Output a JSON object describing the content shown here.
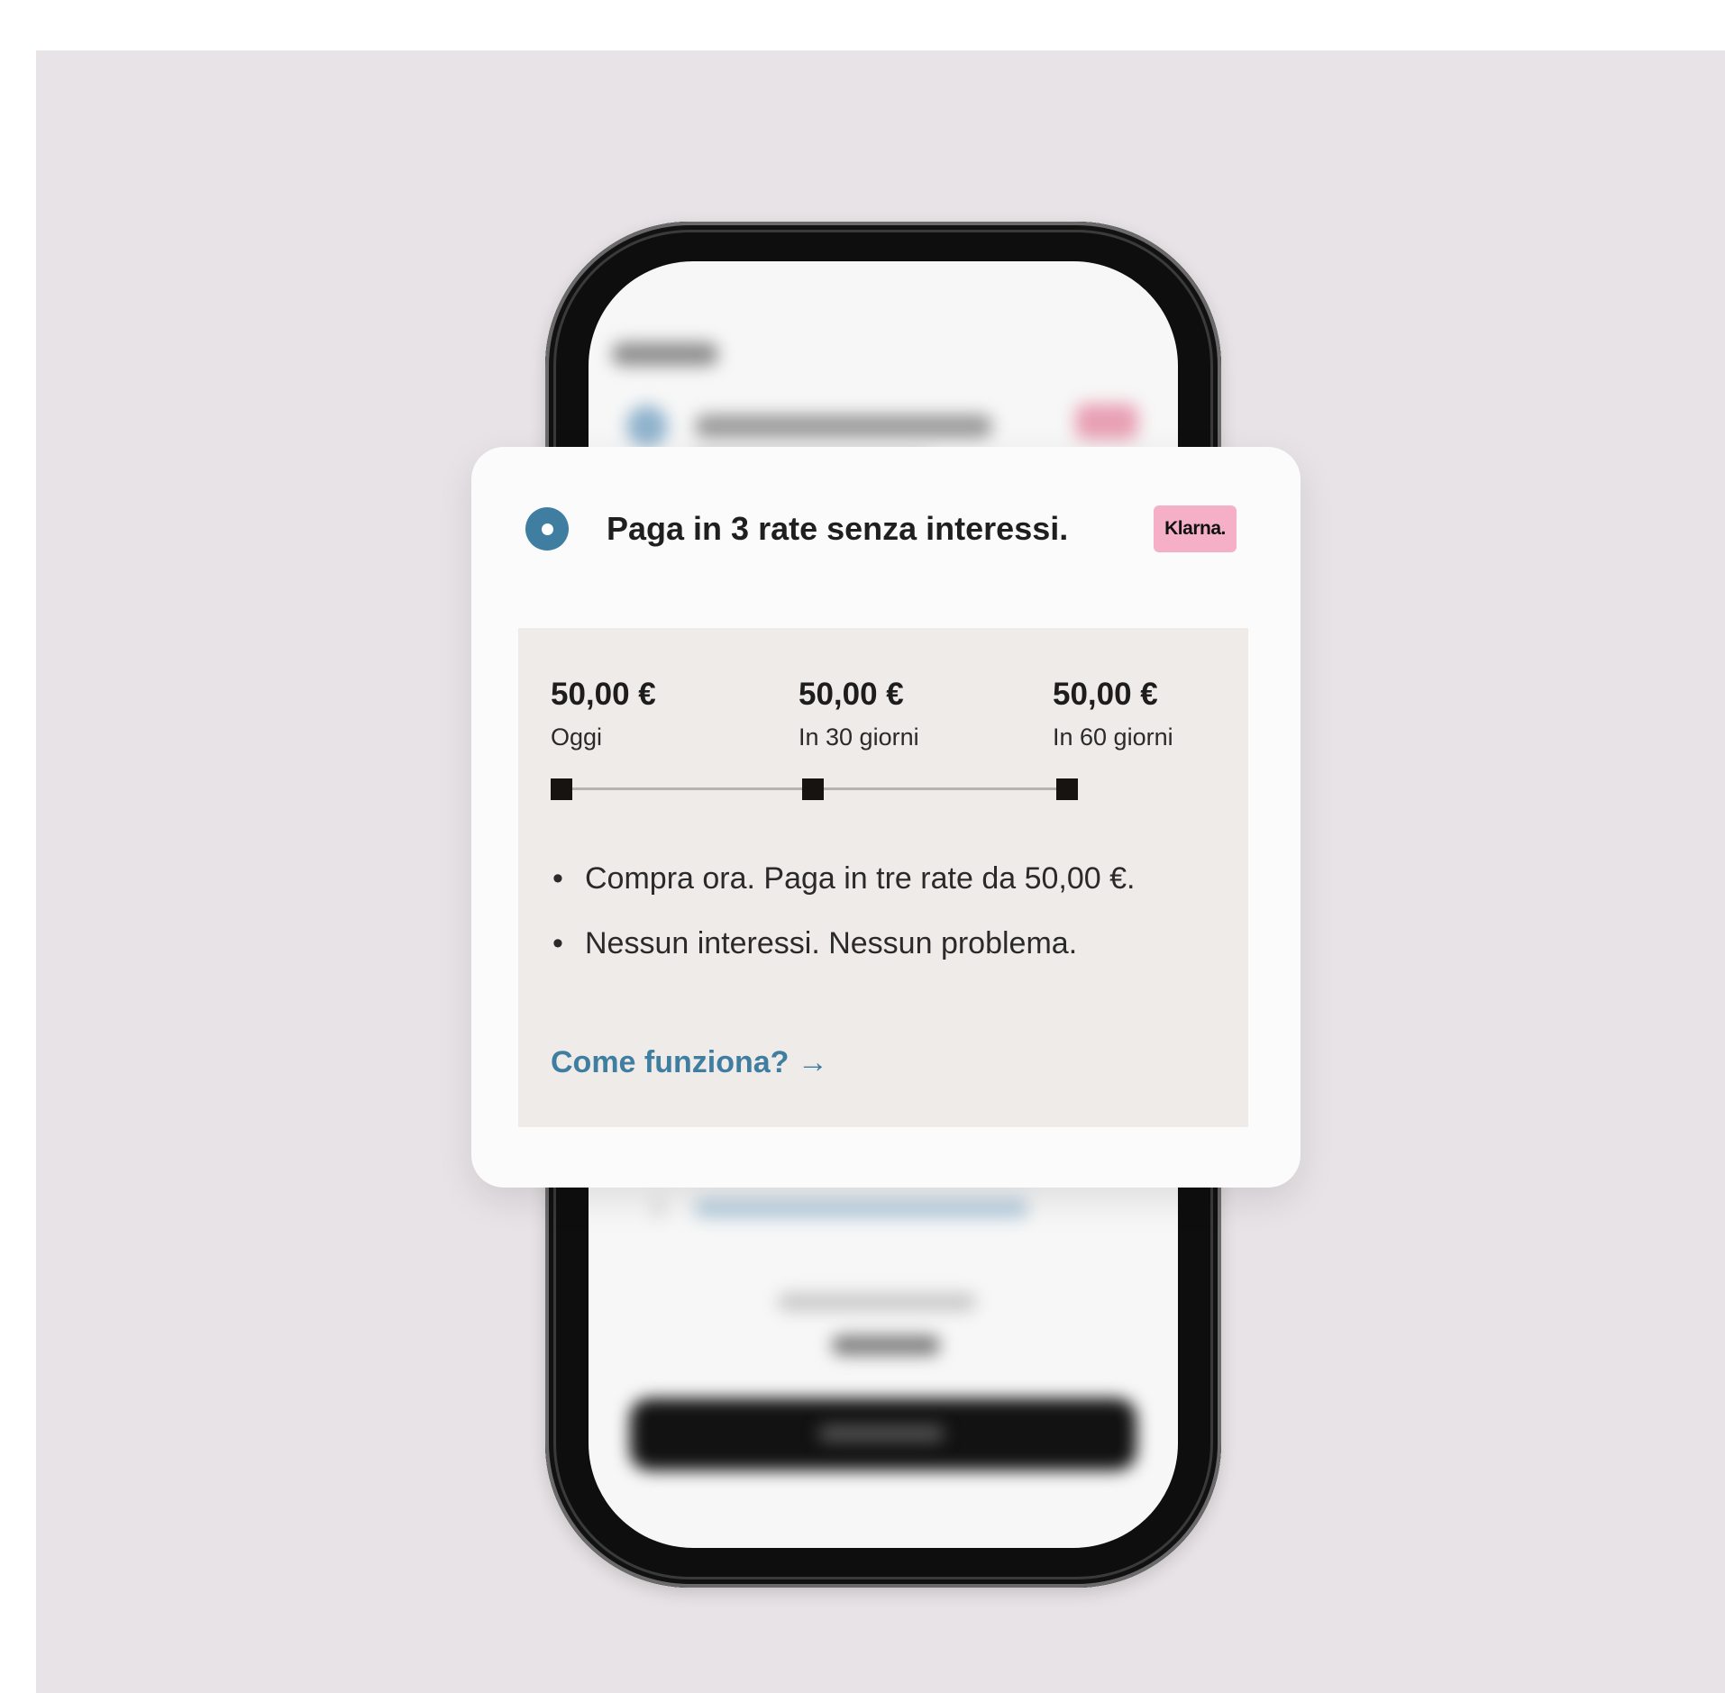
{
  "card": {
    "title": "Paga in 3 rate senza interessi.",
    "brand_badge": "Klarna.",
    "radio_selected": true
  },
  "installments": [
    {
      "amount": "50,00 €",
      "when": "Oggi"
    },
    {
      "amount": "50,00 €",
      "when": "In 30 giorni"
    },
    {
      "amount": "50,00 €",
      "when": "In 60 giorni"
    }
  ],
  "bullets": [
    "Compra ora. Paga in tre rate da 50,00 €.",
    "Nessun interessi. Nessun problema."
  ],
  "link": {
    "label": "Come funziona?",
    "arrow": "→"
  },
  "colors": {
    "accent": "#3f7ea0",
    "klarna_pink": "#f5b0c8",
    "background": "#e8e3e6",
    "plan_panel": "#efebe8"
  },
  "icons": [
    "radio-selected-icon",
    "arrow-right-icon",
    "bullet-dot-icon"
  ]
}
